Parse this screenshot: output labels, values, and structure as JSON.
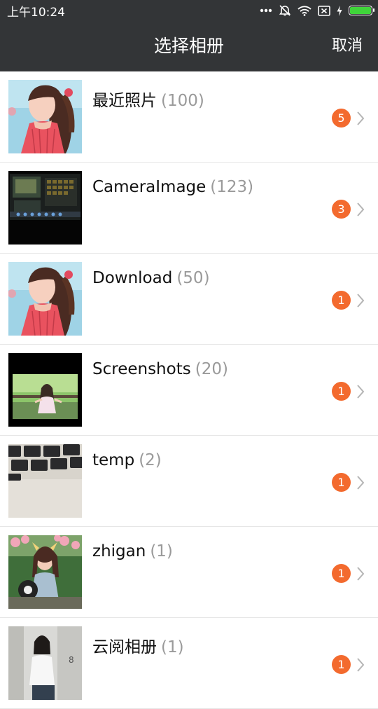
{
  "status_bar": {
    "time": "上午10:24",
    "icons": [
      "more-dots-icon",
      "alarm-off-icon",
      "wifi-icon",
      "no-sim-icon",
      "charging-icon",
      "battery-icon"
    ],
    "battery_color": "#3fd43a"
  },
  "header": {
    "title": "选择相册",
    "cancel_label": "取消",
    "background": "#333537"
  },
  "albums": [
    {
      "name": "最近照片",
      "count": "(100)",
      "badge": "5",
      "thumb": "girl-pink-dress-photo"
    },
    {
      "name": "CameraImage",
      "count": "(123)",
      "badge": "3",
      "thumb": "monitor-screen-photo"
    },
    {
      "name": "Download",
      "count": "(50)",
      "badge": "1",
      "thumb": "girl-pink-dress-photo"
    },
    {
      "name": "Screenshots",
      "count": "(20)",
      "badge": "1",
      "thumb": "girl-outdoor-screenshot"
    },
    {
      "name": "temp",
      "count": "(2)",
      "badge": "1",
      "thumb": "keyboard-photo"
    },
    {
      "name": "zhigan",
      "count": "(1)",
      "badge": "1",
      "thumb": "girl-flowers-photo"
    },
    {
      "name": "云阅相册",
      "count": "(1)",
      "badge": "1",
      "thumb": "girl-white-shirt-photo"
    }
  ],
  "colors": {
    "badge": "#f36a2e",
    "count_text": "#9a9a9a",
    "divider": "#e6e6e6"
  }
}
